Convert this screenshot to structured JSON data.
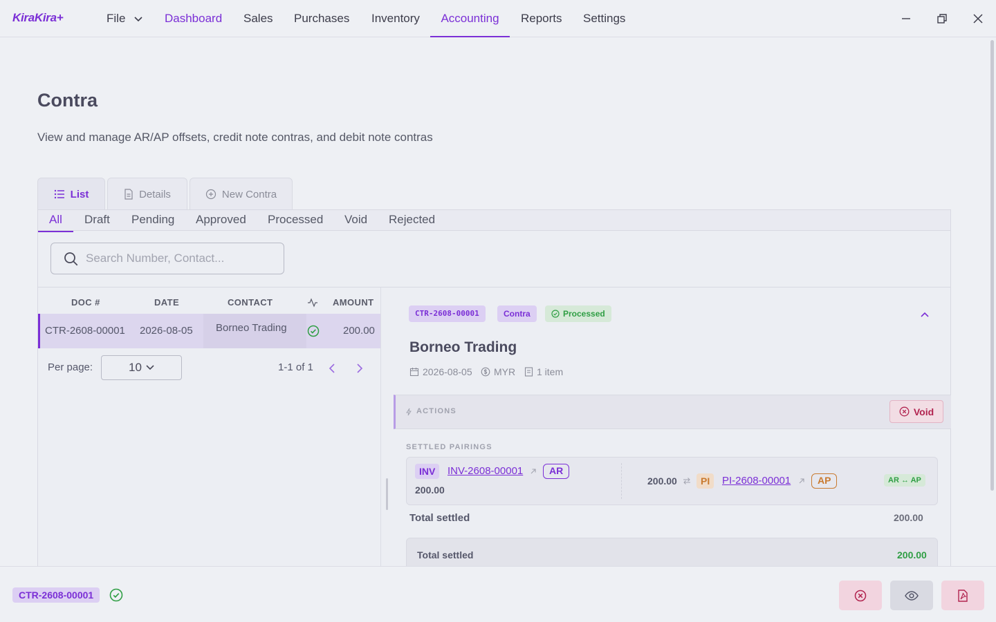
{
  "app": {
    "brand": "KiraKira+"
  },
  "menu": {
    "file": "File",
    "items": [
      "Dashboard",
      "Sales",
      "Purchases",
      "Inventory",
      "Accounting",
      "Reports",
      "Settings"
    ]
  },
  "page": {
    "title": "Contra",
    "subtitle": "View and manage AR/AP offsets, credit note contras, and debit note contras"
  },
  "tabs": {
    "list": "List",
    "details": "Details",
    "new": "New Contra"
  },
  "status_tabs": [
    "All",
    "Draft",
    "Pending",
    "Approved",
    "Processed",
    "Void",
    "Rejected"
  ],
  "search": {
    "placeholder": "Search Number, Contact..."
  },
  "table": {
    "headers": {
      "doc": "DOC #",
      "date": "DATE",
      "contact": "CONTACT",
      "amount": "AMOUNT"
    },
    "rows": [
      {
        "doc": "CTR-2608-00001",
        "date": "2026-08-05",
        "contact": "Borneo Trading",
        "amount": "200.00",
        "status_icon": "check-circle-icon"
      }
    ]
  },
  "pagination": {
    "per_page_label": "Per page:",
    "per_page_value": "10",
    "range": "1-1 of 1"
  },
  "detail": {
    "doc_no": "CTR-2608-00001",
    "type": "Contra",
    "status": "Processed",
    "contact": "Borneo Trading",
    "date": "2026-08-05",
    "currency": "MYR",
    "items": "1 item",
    "actions_label": "ACTIONS",
    "void_label": "Void",
    "settled_label": "SETTLED PAIRINGS",
    "pairing": {
      "left_type": "INV",
      "left_doc": "INV-2608-00001",
      "left_side": "AR",
      "left_amount": "200.00",
      "right_amount": "200.00",
      "right_type": "PI",
      "right_doc": "PI-2608-00001",
      "right_side": "AP",
      "tag": "AR ↔ AP"
    },
    "total_label": "Total settled",
    "total_value": "200.00",
    "total_card_label": "Total settled",
    "total_card_value": "200.00"
  },
  "bottom": {
    "doc_no": "CTR-2608-00001"
  },
  "colors": {
    "accent": "#7b2fd6",
    "success": "#2f9e44",
    "danger": "#b1234f",
    "warning": "#c97a2f"
  }
}
